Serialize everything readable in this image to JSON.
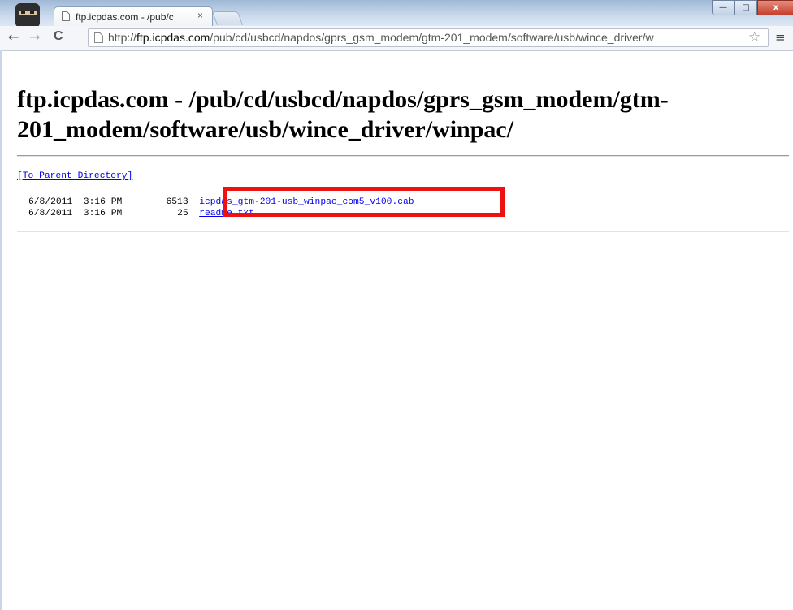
{
  "browser": {
    "tab_title": "ftp.icpdas.com - /pub/c",
    "tab_close": "×",
    "url_prefix": "http://",
    "url_host": "ftp.icpdas.com",
    "url_path": "/pub/cd/usbcd/napdos/gprs_gsm_modem/gtm-201_modem/software/usb/wince_driver/w",
    "back": "←",
    "forward": "→",
    "reload": "C",
    "star": "☆",
    "menu": "≡",
    "window_min": "—",
    "window_max": "□",
    "window_close": "x"
  },
  "page": {
    "heading": "ftp.icpdas.com - /pub/cd/usbcd/napdos/gprs_gsm_modem/gtm-201_modem/software/usb/wince_driver/winpac/",
    "parent_link": "[To Parent Directory]",
    "entries": [
      {
        "date": "6/8/2011",
        "time": "3:16 PM",
        "size": "6513",
        "name": "icpdas_gtm-201-usb_winpac_com5_v100.cab"
      },
      {
        "date": "6/8/2011",
        "time": "3:16 PM",
        "size": "25",
        "name": "readme.txt"
      }
    ]
  },
  "colors": {
    "link": "#0000ee",
    "highlight": "#ee1111"
  }
}
